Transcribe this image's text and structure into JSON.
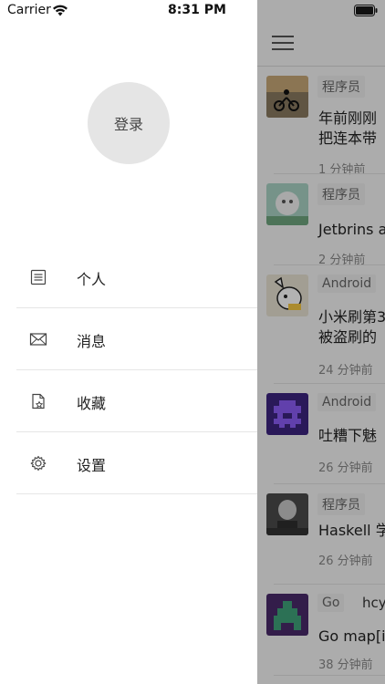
{
  "status_bar": {
    "carrier": "Carrier",
    "time": "8:31 PM"
  },
  "drawer": {
    "login_label": "登录",
    "menu": [
      {
        "label": "个人",
        "icon": "profile-list-icon"
      },
      {
        "label": "消息",
        "icon": "envelope-icon"
      },
      {
        "label": "收藏",
        "icon": "bookmark-star-icon"
      },
      {
        "label": "设置",
        "icon": "gear-icon"
      }
    ]
  },
  "main": {
    "menu_icon": "hamburger-icon",
    "feed": [
      {
        "tag": "程序员",
        "title_line1": "年前刚刚",
        "title_line2": "把连本带",
        "time": "1 分钟前"
      },
      {
        "tag": "程序员",
        "title_line1": "Jetbrins a",
        "title_line2": "",
        "time": "2 分钟前"
      },
      {
        "tag": "Android",
        "title_line1": "小米刷第3",
        "title_line2": "被盗刷的",
        "time": "24 分钟前"
      },
      {
        "tag": "Android",
        "title_line1": "吐糟下魅",
        "title_line2": "",
        "time": "26 分钟前"
      },
      {
        "tag": "程序员",
        "title_line1": "Haskell 学",
        "title_line2": "",
        "time": "26 分钟前"
      },
      {
        "tag": "Go",
        "author": "hcy",
        "title_line1": "Go map[in",
        "title_line2": "",
        "time": "38 分钟前"
      }
    ]
  }
}
